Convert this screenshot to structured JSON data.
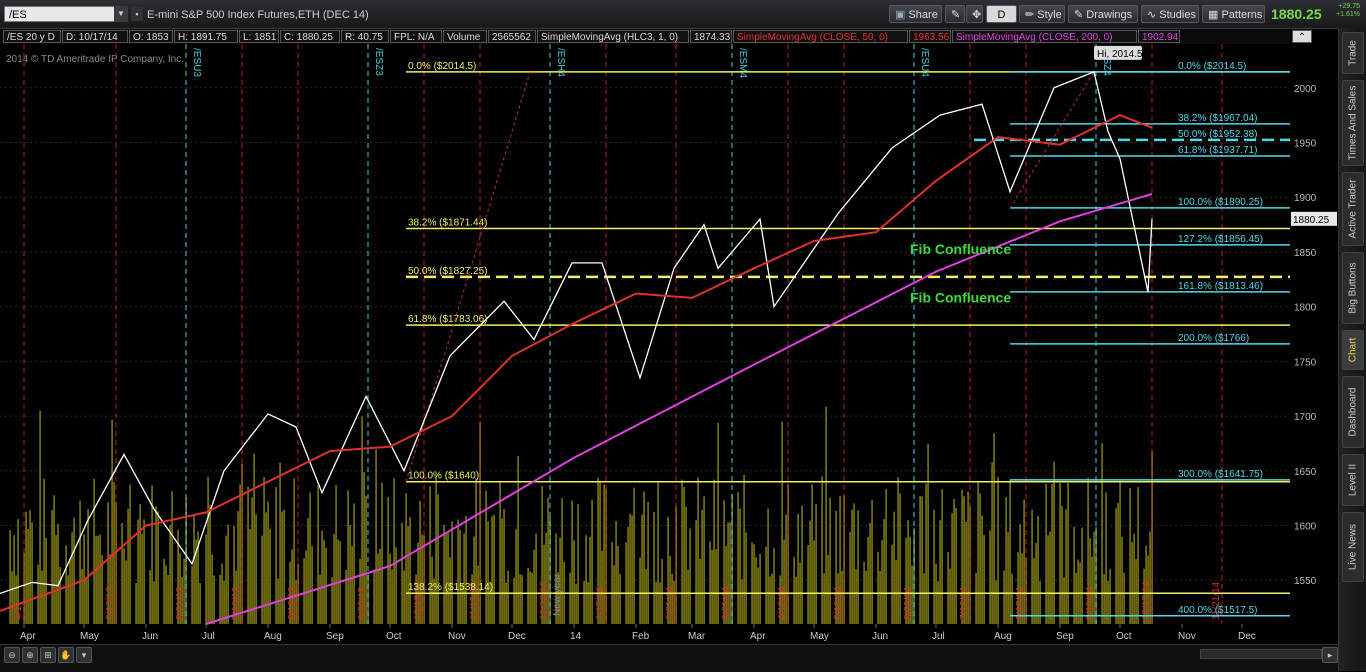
{
  "toolbar": {
    "symbol": "/ES",
    "instrument_title": "E-mini S&P 500 Index Futures,ETH (DEC 14)",
    "share_label": "Share",
    "d_label": "D",
    "style_label": "Style",
    "drawings_label": "Drawings",
    "studies_label": "Studies",
    "patterns_label": "Patterns",
    "last_price": "1880.25",
    "change_abs": "+29.75",
    "change_pct": "+1.61%"
  },
  "infobar": {
    "period": "/ES 20 y D",
    "date": "D: 10/17/14",
    "open": "O: 1853",
    "high": "H: 1891.75",
    "low": "L: 1851",
    "close": "C: 1880.25",
    "range": "R: 40.75",
    "fpl": "FPL: N/A",
    "volume_label": "Volume",
    "volume": "2565562",
    "sma_hlc3_label": "SimpleMovingAvg (HLC3, 1, 0)",
    "sma_hlc3_value": "1874.33",
    "sma50_label": "SimpleMovingAvg (CLOSE, 50, 0)",
    "sma50_value": "1963.56",
    "sma200_label": "SimpleMovingAvg (CLOSE, 200, 0)",
    "sma200_value": "1902.94"
  },
  "sidebar": {
    "tabs": [
      "Trade",
      "Times And Sales",
      "Active Trader",
      "Big Buttons",
      "Chart",
      "Dashboard",
      "Level II",
      "Live News"
    ],
    "active": "Chart"
  },
  "chart_data": {
    "type": "line",
    "watermark": "2014 © TD Ameritrade IP Company, Inc.",
    "y_range": [
      1510,
      2040
    ],
    "y_ticks": [
      1550,
      1600,
      1650,
      1700,
      1750,
      1800,
      1850,
      1900,
      1950,
      2000
    ],
    "x_range": [
      "2013-03-20",
      "2014-12-25"
    ],
    "month_labels": [
      {
        "date": "2013-04-01",
        "label": "Apr"
      },
      {
        "date": "2013-05-01",
        "label": "May"
      },
      {
        "date": "2013-06-01",
        "label": "Jun"
      },
      {
        "date": "2013-07-01",
        "label": "Jul"
      },
      {
        "date": "2013-08-01",
        "label": "Aug"
      },
      {
        "date": "2013-09-01",
        "label": "Sep"
      },
      {
        "date": "2013-10-01",
        "label": "Oct"
      },
      {
        "date": "2013-11-01",
        "label": "Nov"
      },
      {
        "date": "2013-12-01",
        "label": "Dec"
      },
      {
        "date": "2014-01-01",
        "label": "14"
      },
      {
        "date": "2014-02-01",
        "label": "Feb"
      },
      {
        "date": "2014-03-01",
        "label": "Mar"
      },
      {
        "date": "2014-04-01",
        "label": "Apr"
      },
      {
        "date": "2014-05-01",
        "label": "May"
      },
      {
        "date": "2014-06-01",
        "label": "Jun"
      },
      {
        "date": "2014-07-01",
        "label": "Jul"
      },
      {
        "date": "2014-08-01",
        "label": "Aug"
      },
      {
        "date": "2014-09-01",
        "label": "Sep"
      },
      {
        "date": "2014-10-01",
        "label": "Oct"
      },
      {
        "date": "2014-11-01",
        "label": "Nov"
      },
      {
        "date": "2014-12-01",
        "label": "Dec"
      }
    ],
    "date_markers": [
      {
        "date": "2013-04-01",
        "label": "4/1"
      },
      {
        "date": "2013-05-17",
        "label": "5/17/13"
      },
      {
        "date": "2013-06-21",
        "label": "6/21/13"
      },
      {
        "date": "2013-07-19",
        "label": "7/19/13"
      },
      {
        "date": "2013-08-16",
        "label": "8/16/13"
      },
      {
        "date": "2013-09-20",
        "label": "9/20/13"
      },
      {
        "date": "2013-10-18",
        "label": "10/18/13"
      },
      {
        "date": "2013-11-15",
        "label": "11/15/13"
      },
      {
        "date": "2013-12-20",
        "label": "12/20/13"
      },
      {
        "date": "2014-01-17",
        "label": "1/17/14"
      },
      {
        "date": "2014-02-21",
        "label": "2/21/14"
      },
      {
        "date": "2014-03-21",
        "label": "3/21/14"
      },
      {
        "date": "2014-04-18",
        "label": "4/18/14"
      },
      {
        "date": "2014-05-16",
        "label": "5/16/14"
      },
      {
        "date": "2014-06-20",
        "label": "6/20/14"
      },
      {
        "date": "2014-07-18",
        "label": "7/18/14"
      },
      {
        "date": "2014-08-15",
        "label": "8/15/14"
      },
      {
        "date": "2014-09-19",
        "label": "9/19/14"
      },
      {
        "date": "2014-10-17",
        "label": "10/17/14"
      },
      {
        "date": "2014-11-21",
        "label": "11/21/14"
      }
    ],
    "expiry_markers": [
      {
        "date": "2013-06-21",
        "label": "/ESU3"
      },
      {
        "date": "2013-09-20",
        "label": "/ESZ3"
      },
      {
        "date": "2013-12-20",
        "label": "/ESH4"
      },
      {
        "date": "2014-03-21",
        "label": "/ESM4"
      },
      {
        "date": "2014-06-20",
        "label": "/ESU4"
      },
      {
        "date": "2014-09-19",
        "label": "/ESZ4"
      }
    ],
    "new_year_label": "New year",
    "series": [
      {
        "name": "Price (/ES daily)",
        "color": "#ffffff",
        "points": [
          [
            "2013-03-20",
            1538
          ],
          [
            "2013-04-05",
            1548
          ],
          [
            "2013-04-18",
            1545
          ],
          [
            "2013-05-03",
            1605
          ],
          [
            "2013-05-21",
            1665
          ],
          [
            "2013-06-05",
            1615
          ],
          [
            "2013-06-24",
            1565
          ],
          [
            "2013-07-10",
            1650
          ],
          [
            "2013-08-01",
            1702
          ],
          [
            "2013-08-15",
            1690
          ],
          [
            "2013-08-28",
            1630
          ],
          [
            "2013-09-19",
            1718
          ],
          [
            "2013-10-08",
            1650
          ],
          [
            "2013-10-31",
            1755
          ],
          [
            "2013-11-27",
            1805
          ],
          [
            "2013-12-12",
            1770
          ],
          [
            "2013-12-31",
            1840
          ],
          [
            "2014-01-15",
            1840
          ],
          [
            "2014-02-03",
            1735
          ],
          [
            "2014-02-20",
            1835
          ],
          [
            "2014-03-07",
            1875
          ],
          [
            "2014-03-14",
            1835
          ],
          [
            "2014-04-04",
            1880
          ],
          [
            "2014-04-11",
            1800
          ],
          [
            "2014-05-13",
            1885
          ],
          [
            "2014-06-09",
            1945
          ],
          [
            "2014-07-03",
            1975
          ],
          [
            "2014-07-24",
            1985
          ],
          [
            "2014-08-07",
            1905
          ],
          [
            "2014-08-29",
            2000
          ],
          [
            "2014-09-18",
            2014.5
          ],
          [
            "2014-09-25",
            1960
          ],
          [
            "2014-10-01",
            1935
          ],
          [
            "2014-10-15",
            1813
          ],
          [
            "2014-10-17",
            1880.25
          ]
        ]
      },
      {
        "name": "SimpleMovingAvg (CLOSE, 50, 0)",
        "color": "#e03030",
        "points": [
          [
            "2013-03-20",
            1522
          ],
          [
            "2013-05-01",
            1550
          ],
          [
            "2013-06-01",
            1600
          ],
          [
            "2013-07-01",
            1612
          ],
          [
            "2013-08-01",
            1640
          ],
          [
            "2013-09-01",
            1668
          ],
          [
            "2013-10-01",
            1672
          ],
          [
            "2013-11-01",
            1700
          ],
          [
            "2013-12-01",
            1755
          ],
          [
            "2014-01-01",
            1785
          ],
          [
            "2014-02-01",
            1812
          ],
          [
            "2014-03-01",
            1808
          ],
          [
            "2014-04-01",
            1835
          ],
          [
            "2014-05-01",
            1860
          ],
          [
            "2014-06-01",
            1868
          ],
          [
            "2014-07-01",
            1915
          ],
          [
            "2014-08-01",
            1955
          ],
          [
            "2014-09-01",
            1948
          ],
          [
            "2014-10-01",
            1975
          ],
          [
            "2014-10-17",
            1963.56
          ]
        ]
      },
      {
        "name": "SimpleMovingAvg (CLOSE, 200, 0)",
        "color": "#e040e0",
        "points": [
          [
            "2013-07-01",
            1510
          ],
          [
            "2013-10-01",
            1563
          ],
          [
            "2014-01-01",
            1662
          ],
          [
            "2014-04-01",
            1747
          ],
          [
            "2014-07-01",
            1832
          ],
          [
            "2014-09-01",
            1878
          ],
          [
            "2014-10-17",
            1902.94
          ]
        ]
      }
    ],
    "fib_left": {
      "color": "#f0f060",
      "levels": [
        {
          "label": "0.0%  ($2014.5)",
          "price": 2014.5
        },
        {
          "label": "38.2%  ($1871.44)",
          "price": 1871.44
        },
        {
          "label": "50.0%  ($1827.25)",
          "price": 1827.25,
          "dashed": true
        },
        {
          "label": "61.8%  ($1783.06)",
          "price": 1783.06
        },
        {
          "label": "100.0%  ($1640)",
          "price": 1640
        },
        {
          "label": "138.2%  ($1538.14)",
          "price": 1538.14
        }
      ]
    },
    "fib_right": {
      "color": "#4fd8e8",
      "levels": [
        {
          "label": "0.0%  ($2014.5)",
          "price": 2014.5
        },
        {
          "label": "38.2%  ($1967.04)",
          "price": 1967.04
        },
        {
          "label": "50.0%  ($1952.38)",
          "price": 1952.38,
          "dashed": true
        },
        {
          "label": "61.8%  ($1937.71)",
          "price": 1937.71
        },
        {
          "label": "100.0%  ($1890.25)",
          "price": 1890.25
        },
        {
          "label": "127.2%  ($1856.45)",
          "price": 1856.45
        },
        {
          "label": "161.8%  ($1813.46)",
          "price": 1813.46
        },
        {
          "label": "200.0%  ($1766)",
          "price": 1766
        },
        {
          "label": "300.0%  ($1641.75)",
          "price": 1641.75
        },
        {
          "label": "400.0%  ($1517.5)",
          "price": 1517.5
        }
      ]
    },
    "annotations": [
      {
        "text": "Fib Confluence",
        "price": 1848,
        "date": "2014-06-18"
      },
      {
        "text": "Fib Confluence",
        "price": 1804,
        "date": "2014-06-18"
      }
    ],
    "high_label": "Hi, 2014.5",
    "price_tag": "1880.25",
    "volume_color": "#6e6a10"
  }
}
